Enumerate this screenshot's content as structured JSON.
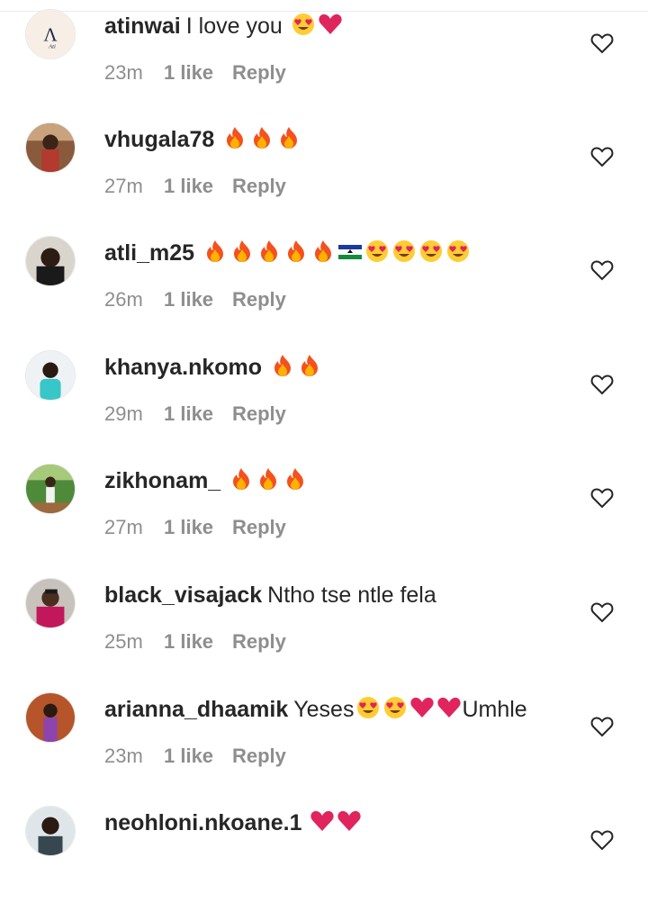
{
  "comments": [
    {
      "username": "atinwai",
      "text": "I love you",
      "emojis": [
        "heart-eyes",
        "red-heart"
      ],
      "time": "23m",
      "likes": "1 like",
      "reply": "Reply",
      "avatar": "logo-a"
    },
    {
      "username": "vhugala78",
      "text": "",
      "emojis": [
        "fire",
        "fire",
        "fire"
      ],
      "time": "27m",
      "likes": "1 like",
      "reply": "Reply",
      "avatar": "person"
    },
    {
      "username": "atli_m25",
      "text": "",
      "emojis": [
        "fire",
        "fire",
        "fire",
        "fire",
        "fire",
        "flag-lesotho",
        "heart-eyes",
        "heart-eyes",
        "heart-eyes",
        "heart-eyes"
      ],
      "time": "26m",
      "likes": "1 like",
      "reply": "Reply",
      "avatar": "person"
    },
    {
      "username": "khanya.nkomo",
      "text": "",
      "emojis": [
        "fire",
        "fire"
      ],
      "time": "29m",
      "likes": "1 like",
      "reply": "Reply",
      "avatar": "person"
    },
    {
      "username": "zikhonam_",
      "text": "",
      "emojis": [
        "fire",
        "fire",
        "fire"
      ],
      "time": "27m",
      "likes": "1 like",
      "reply": "Reply",
      "avatar": "person-outdoor"
    },
    {
      "username": "black_visajack",
      "text": "Ntho tse ntle fela",
      "emojis": [],
      "time": "25m",
      "likes": "1 like",
      "reply": "Reply",
      "avatar": "person"
    },
    {
      "username": "arianna_dhaamik",
      "text": "Yeses",
      "emojis": [
        "heart-eyes",
        "heart-eyes",
        "red-heart",
        "red-heart"
      ],
      "text_after": "Umhle",
      "time": "23m",
      "likes": "1 like",
      "reply": "Reply",
      "avatar": "person-purple"
    },
    {
      "username": "neohloni.nkoane.1",
      "text": "",
      "emojis": [
        "red-heart",
        "red-heart"
      ],
      "time": "",
      "likes": "",
      "reply": "",
      "avatar": "person"
    }
  ],
  "colors": {
    "username": "#262626",
    "meta": "#8e8e8e",
    "heart": "#262626",
    "fire": "#f4511e",
    "love": "#e0245e"
  }
}
